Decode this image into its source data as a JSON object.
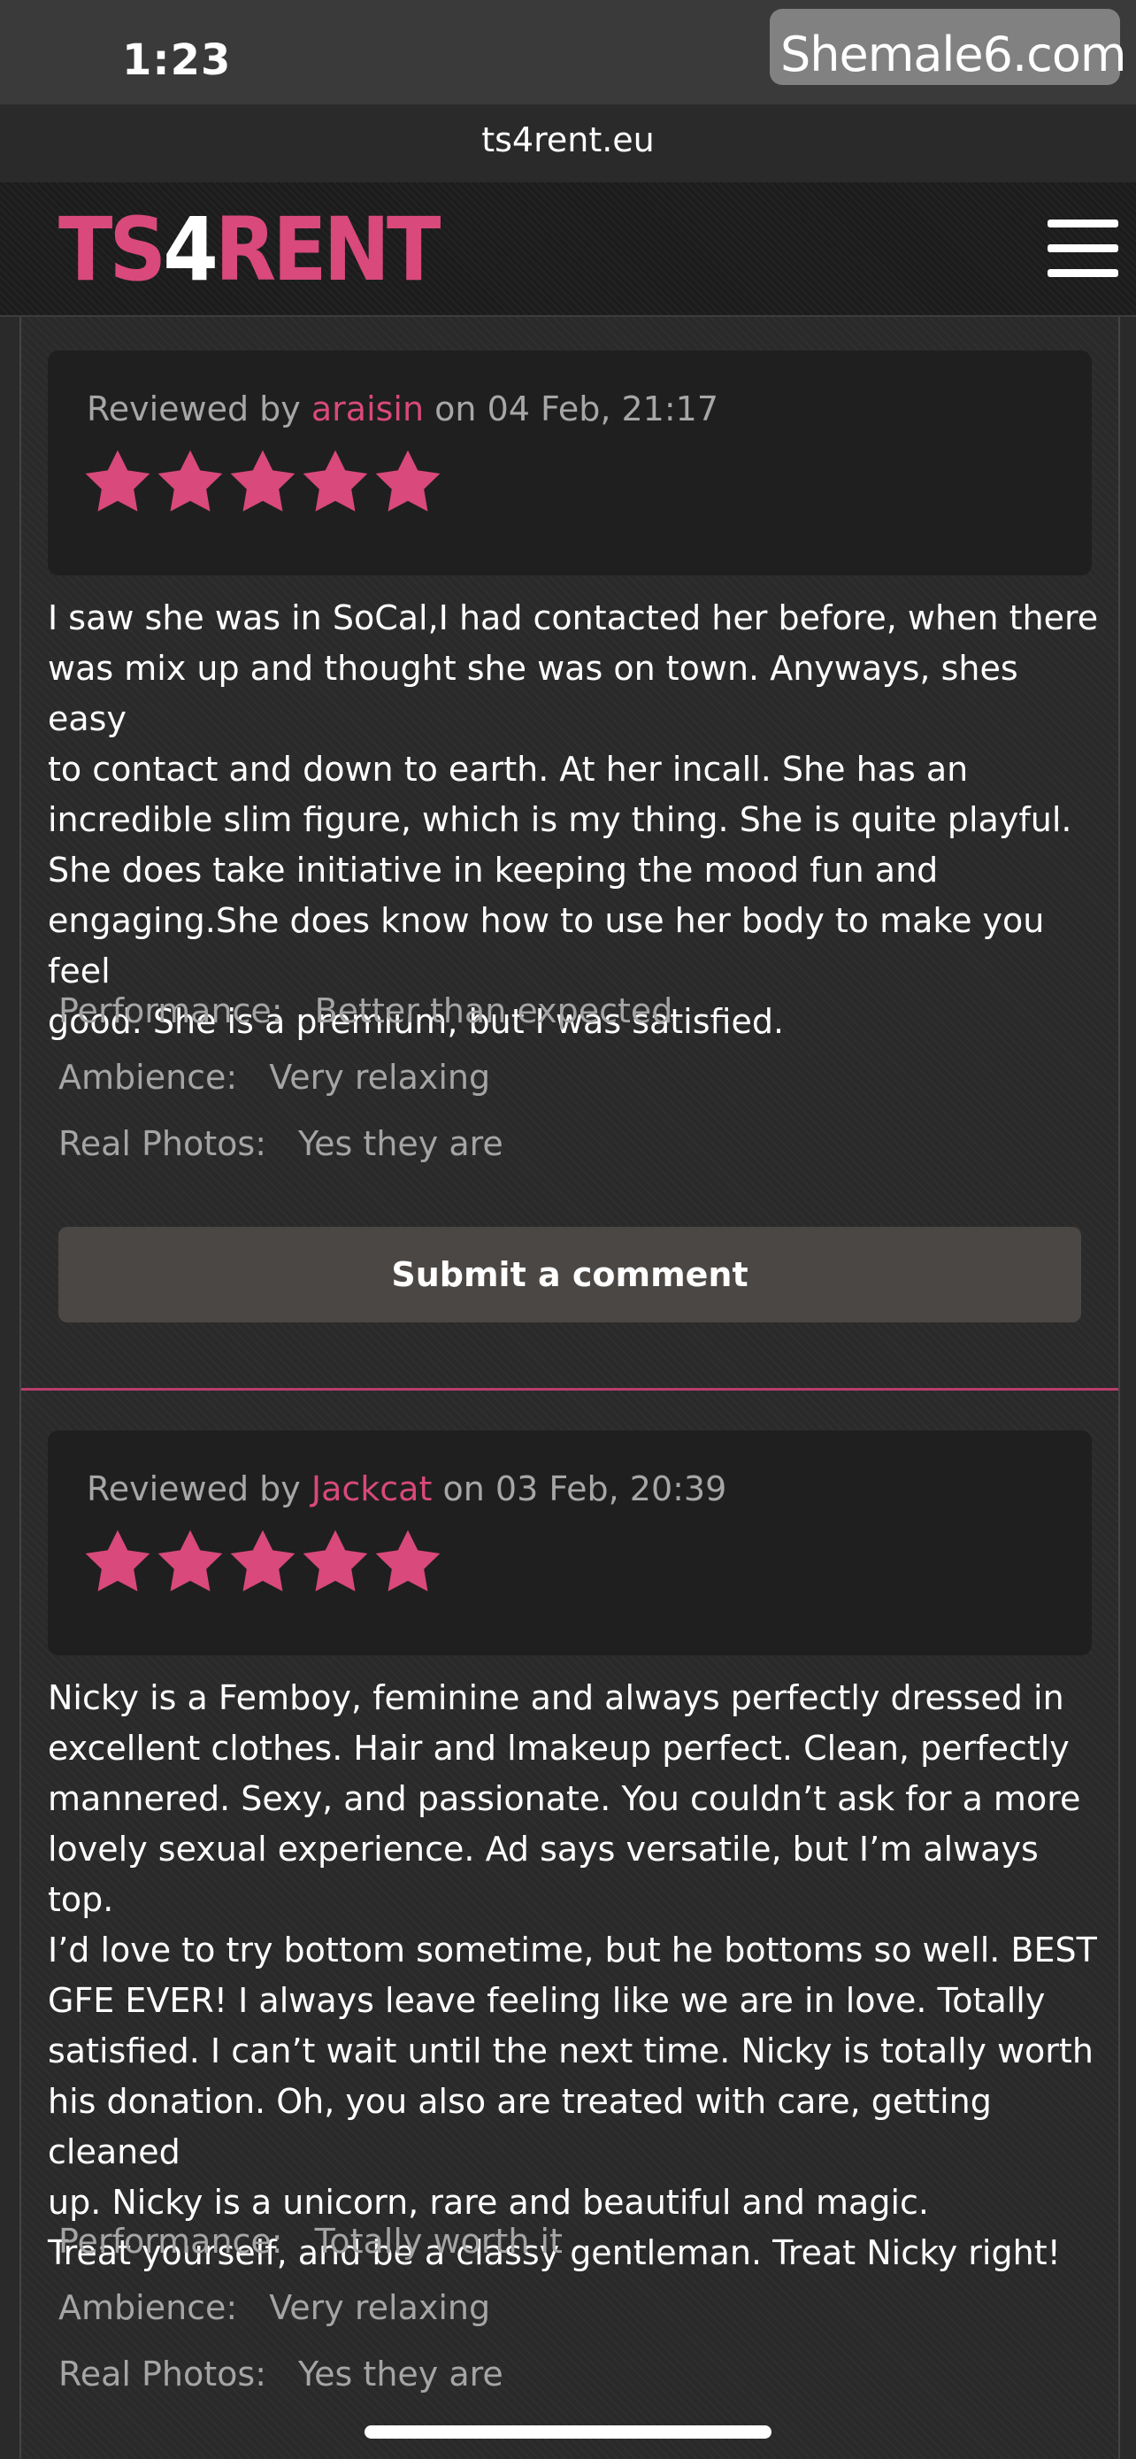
{
  "status_bar": {
    "time": "1:23"
  },
  "watermark": {
    "text": "Shemale6.com"
  },
  "browser": {
    "url": "ts4rent.eu"
  },
  "site": {
    "logo_part1": "TS",
    "logo_part2": "4",
    "logo_part3": "RENT",
    "accent_color": "#d9497b"
  },
  "labels": {
    "reviewed_by": "Reviewed by",
    "on": "on",
    "performance": "Performance:",
    "ambience": "Ambience:",
    "real_photos": "Real Photos:",
    "submit_comment": "Submit a comment"
  },
  "reviews": [
    {
      "user": "araisin",
      "date": "04 Feb, 21:17",
      "stars": 5,
      "text": "I saw she was in SoCal,I had contacted her before, when there\nwas mix up and thought she was on town. Anyways, shes easy\nto contact and down to earth. At her incall. She has an\nincredible slim figure, which is my thing. She is quite playful.\nShe does take initiative in keeping the mood fun and\nengaging.She does know how to use her body to make you feel\ngood. She is a premium, but I was satisfied.",
      "performance": "Better than expected",
      "ambience": "Very relaxing",
      "real_photos": "Yes they are"
    },
    {
      "user": "Jackcat",
      "date": "03 Feb, 20:39",
      "stars": 5,
      "text": "Nicky is a Femboy, feminine and always perfectly dressed in\nexcellent clothes. Hair and lmakeup perfect. Clean, perfectly\nmannered. Sexy, and passionate. You couldn’t ask for a more\nlovely sexual experience. Ad says versatile, but I’m always top.\nI’d love to try bottom sometime, but he bottoms so well. BEST\nGFE EVER! I always leave feeling like we are in love. Totally\nsatisfied. I can’t wait until the next time. Nicky is totally worth\nhis donation. Oh, you also are treated with care, getting cleaned\nup. Nicky is a unicorn, rare and beautiful and magic.\nTreat yourself, and be a classy gentleman. Treat Nicky right!",
      "performance": "Totally worth it",
      "ambience": "Very relaxing",
      "real_photos": "Yes they are"
    }
  ]
}
